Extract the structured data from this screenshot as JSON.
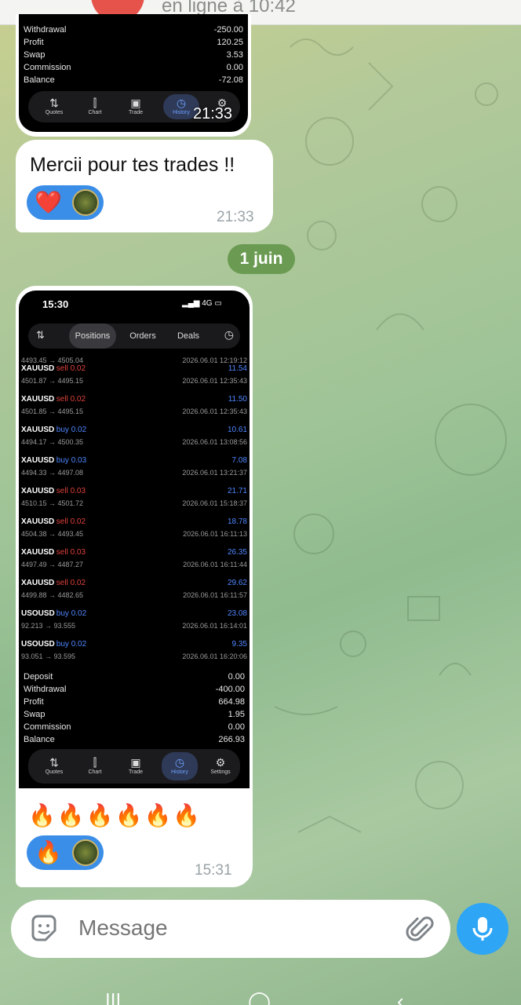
{
  "header": {
    "status": "en ligne à 10:42"
  },
  "first_screenshot": {
    "summary": [
      {
        "label": "Withdrawal",
        "value": "-250.00"
      },
      {
        "label": "Profit",
        "value": "120.25"
      },
      {
        "label": "Swap",
        "value": "3.53"
      },
      {
        "label": "Commission",
        "value": "0.00"
      },
      {
        "label": "Balance",
        "value": "-72.08"
      }
    ],
    "nav": [
      {
        "label": "Quotes",
        "icon": "arrows-updown-icon"
      },
      {
        "label": "Chart",
        "icon": "candles-icon"
      },
      {
        "label": "Trade",
        "icon": "chart-trade-icon"
      },
      {
        "label": "History",
        "icon": "history-clock-icon"
      },
      {
        "label": "Settings",
        "icon": "gear-icon"
      }
    ],
    "time": "21:33"
  },
  "text_message": {
    "text": "Mercii pour tes trades !!",
    "reaction": "❤️",
    "time": "21:33"
  },
  "date_separator": "1 juin",
  "second_screenshot": {
    "phone_time": "15:30",
    "signal": "4G",
    "tabs": [
      "Positions",
      "Orders",
      "Deals"
    ],
    "first_row": {
      "prices": "4493.45 → 4505.04",
      "date": "2026.06.01 12:19:12"
    },
    "trades": [
      {
        "symbol": "XAUUSD",
        "dir": "sell 0.02",
        "pnl": "11.54",
        "prices": "4501.87 → 4495.15",
        "date": "2026.06.01 12:35:43"
      },
      {
        "symbol": "XAUUSD",
        "dir": "sell 0.02",
        "pnl": "11.50",
        "prices": "4501.85 → 4495.15",
        "date": "2026.06.01 12:35:43"
      },
      {
        "symbol": "XAUUSD",
        "dir": "buy 0.02",
        "pnl": "10.61",
        "prices": "4494.17 → 4500.35",
        "date": "2026.06.01 13:08:56"
      },
      {
        "symbol": "XAUUSD",
        "dir": "buy 0.03",
        "pnl": "7.08",
        "prices": "4494.33 → 4497.08",
        "date": "2026.06.01 13:21:37"
      },
      {
        "symbol": "XAUUSD",
        "dir": "sell 0.03",
        "pnl": "21.71",
        "prices": "4510.15 → 4501.72",
        "date": "2026.06.01 15:18:37"
      },
      {
        "symbol": "XAUUSD",
        "dir": "sell 0.02",
        "pnl": "18.78",
        "prices": "4504.38 → 4493.45",
        "date": "2026.06.01 16:11:13"
      },
      {
        "symbol": "XAUUSD",
        "dir": "sell 0.03",
        "pnl": "26.35",
        "prices": "4497.49 → 4487.27",
        "date": "2026.06.01 16:11:44"
      },
      {
        "symbol": "XAUUSD",
        "dir": "sell 0.02",
        "pnl": "29.62",
        "prices": "4499.88 → 4482.65",
        "date": "2026.06.01 16:11:57"
      },
      {
        "symbol": "USOUSD",
        "dir": "buy 0.02",
        "pnl": "23.08",
        "prices": "92.213 → 93.555",
        "date": "2026.06.01 16:14:01"
      },
      {
        "symbol": "USOUSD",
        "dir": "buy 0.02",
        "pnl": "9.35",
        "prices": "93.051 → 93.595",
        "date": "2026.06.01 16:20:06"
      }
    ],
    "summary": [
      {
        "label": "Deposit",
        "value": "0.00"
      },
      {
        "label": "Withdrawal",
        "value": "-400.00"
      },
      {
        "label": "Profit",
        "value": "664.98"
      },
      {
        "label": "Swap",
        "value": "1.95"
      },
      {
        "label": "Commission",
        "value": "0.00"
      },
      {
        "label": "Balance",
        "value": "266.93"
      }
    ],
    "nav": [
      {
        "label": "Quotes"
      },
      {
        "label": "Chart"
      },
      {
        "label": "Trade"
      },
      {
        "label": "History"
      },
      {
        "label": "Settings"
      }
    ]
  },
  "photo_caption": {
    "text": "🔥🔥🔥🔥🔥🔥",
    "reaction": "🔥",
    "time": "15:31"
  },
  "composer": {
    "placeholder": "Message"
  },
  "colors": {
    "accent": "#2ea6f5",
    "reaction_pill": "#3b8ee8",
    "date_chip": "#6b9b52",
    "sell": "#e0413c",
    "buy": "#4f86ff"
  }
}
